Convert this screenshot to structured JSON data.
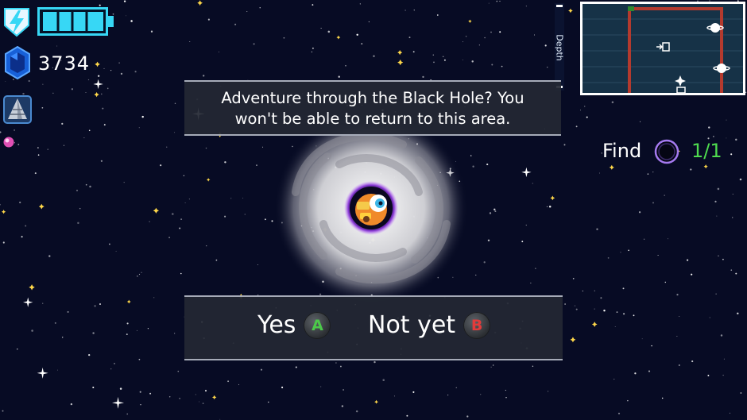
{
  "hud": {
    "battery_level": 1.0,
    "gem_count": "3734",
    "energy_icon": "lightning-shield-icon",
    "gem_icon": "blue-gem-icon",
    "drill_icon": "drill-icon"
  },
  "depth": {
    "label": "Depth"
  },
  "objective": {
    "label": "Find",
    "count": "1/1",
    "icon": "black-hole-icon"
  },
  "dialog": {
    "prompt": "Adventure through the Black Hole? You\nwon't be able to return to this area.",
    "yes_label": "Yes",
    "yes_button": "A",
    "no_label": "Not yet",
    "no_button": "B"
  },
  "colors": {
    "space": "#070b24",
    "hud_cyan": "#37d7f5",
    "objective_green": "#4fdc4f",
    "button_a": "#4cc94a",
    "button_b": "#e23b3b",
    "minimap_wall": "#b43a2e"
  }
}
